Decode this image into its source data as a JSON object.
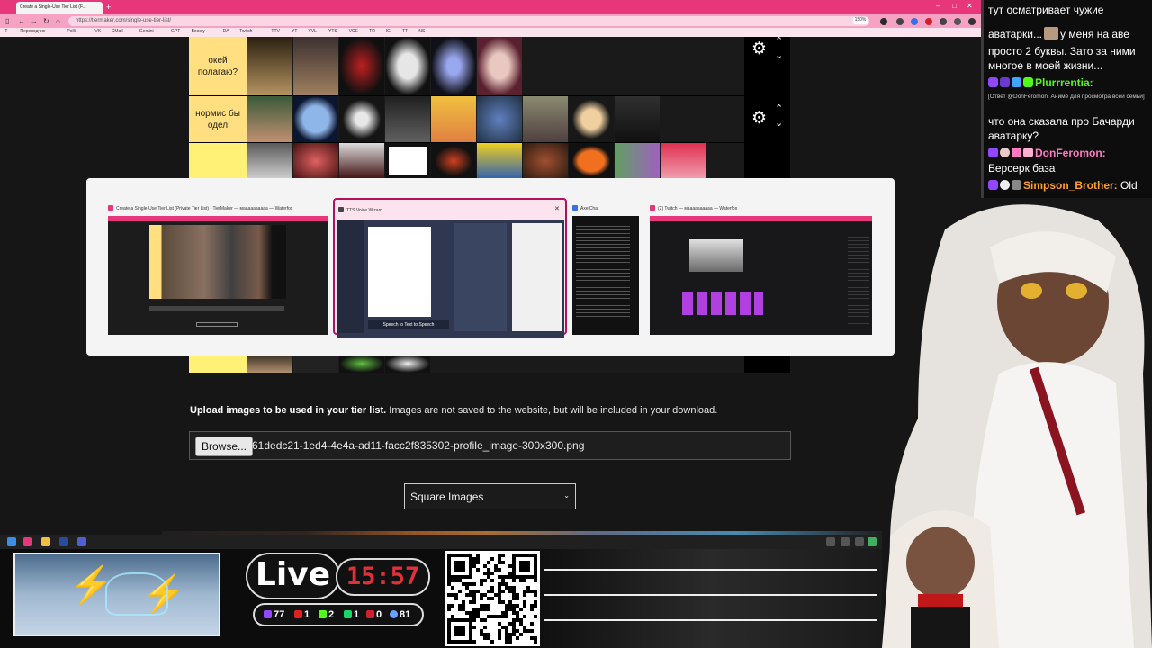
{
  "browser": {
    "tab_title": "Create a Single-Use Tier List (F...",
    "url": "https://tiermaker.com/single-use-tier-list/",
    "zoom": "150%",
    "bookmarks": [
      "IT",
      "Переводчик",
      "Polli",
      "VK",
      "CMail",
      "Gemini",
      "GPT",
      "Boosty",
      "DA",
      "Twitch",
      "TTV",
      "YT",
      "YVL",
      "YTS",
      "VCE",
      "TR",
      "IG",
      "TT",
      "NS"
    ]
  },
  "tierlist": {
    "rows": [
      {
        "label": "окей полагаю?"
      },
      {
        "label": "нормис бы одел"
      },
      {
        "label": ""
      }
    ]
  },
  "switcher": {
    "windows": [
      {
        "title": "Create a Single-Use Tier List (Private Tier List) - TierMaker — маааааааааа — Waterfox",
        "icon_color": "#e8367a"
      },
      {
        "title": "TTS Voice Wizard",
        "icon_color": "#444",
        "selected": true
      },
      {
        "title": "AxelChat",
        "icon_color": "#3a6ee8"
      },
      {
        "title": "(2) Twitch — маааааааааа — Waterfox",
        "icon_color": "#e8367a"
      }
    ],
    "tts_button": "Speech to Text to Speech"
  },
  "upload": {
    "heading_bold": "Upload images to be used in your tier list.",
    "heading_rest": " Images are not saved to the website, but will be included in your download.",
    "browse_label": "Browse...",
    "file_name": "61dedc21-1ed4-4e4a-ad11-facc2f835302-profile_image-300x300.png",
    "image_shape_selected": "Square Images"
  },
  "overlay": {
    "live_label": "Live",
    "clock": "15:57",
    "stats": [
      {
        "icon": "twitch-icon",
        "color": "#9146ff",
        "value": "77"
      },
      {
        "icon": "youtube-icon",
        "color": "#e02020",
        "value": "1"
      },
      {
        "icon": "kick-icon",
        "color": "#53fc18",
        "value": "2"
      },
      {
        "icon": "trovo-icon",
        "color": "#19d66b",
        "value": "1"
      },
      {
        "icon": "vk-icon",
        "color": "#d02030",
        "value": "0"
      },
      {
        "icon": "viewers-icon",
        "color": "#6aa0ff",
        "value": "81"
      }
    ]
  },
  "chat": {
    "lines": [
      {
        "text": "тут осматривает чужие",
        "type": "msg"
      },
      {
        "text": "аватарки...",
        "text2": "у меня на аве",
        "type": "msg_avatar"
      },
      {
        "text": "просто 2 буквы. Зато за ними",
        "type": "msg"
      },
      {
        "text": "многое в моей жизни...",
        "type": "msg"
      },
      {
        "user": "Plurrrentia:",
        "color": "#53fc18",
        "type": "user"
      },
      {
        "text": "[Ответ @DonFeromon: Аниме для просмотра всей семьи]",
        "type": "reply"
      },
      {
        "text": "что она сказала про Бачарди",
        "type": "msg"
      },
      {
        "text": "аватарку?",
        "type": "msg"
      },
      {
        "user": "DonFeromon:",
        "color": "#ff7ac1",
        "type": "user"
      },
      {
        "text": "Берсерк база",
        "type": "msg"
      },
      {
        "user": "Simpson_Brother:",
        "color": "#ff9f2e",
        "text": "Old",
        "type": "user_msg"
      }
    ]
  }
}
